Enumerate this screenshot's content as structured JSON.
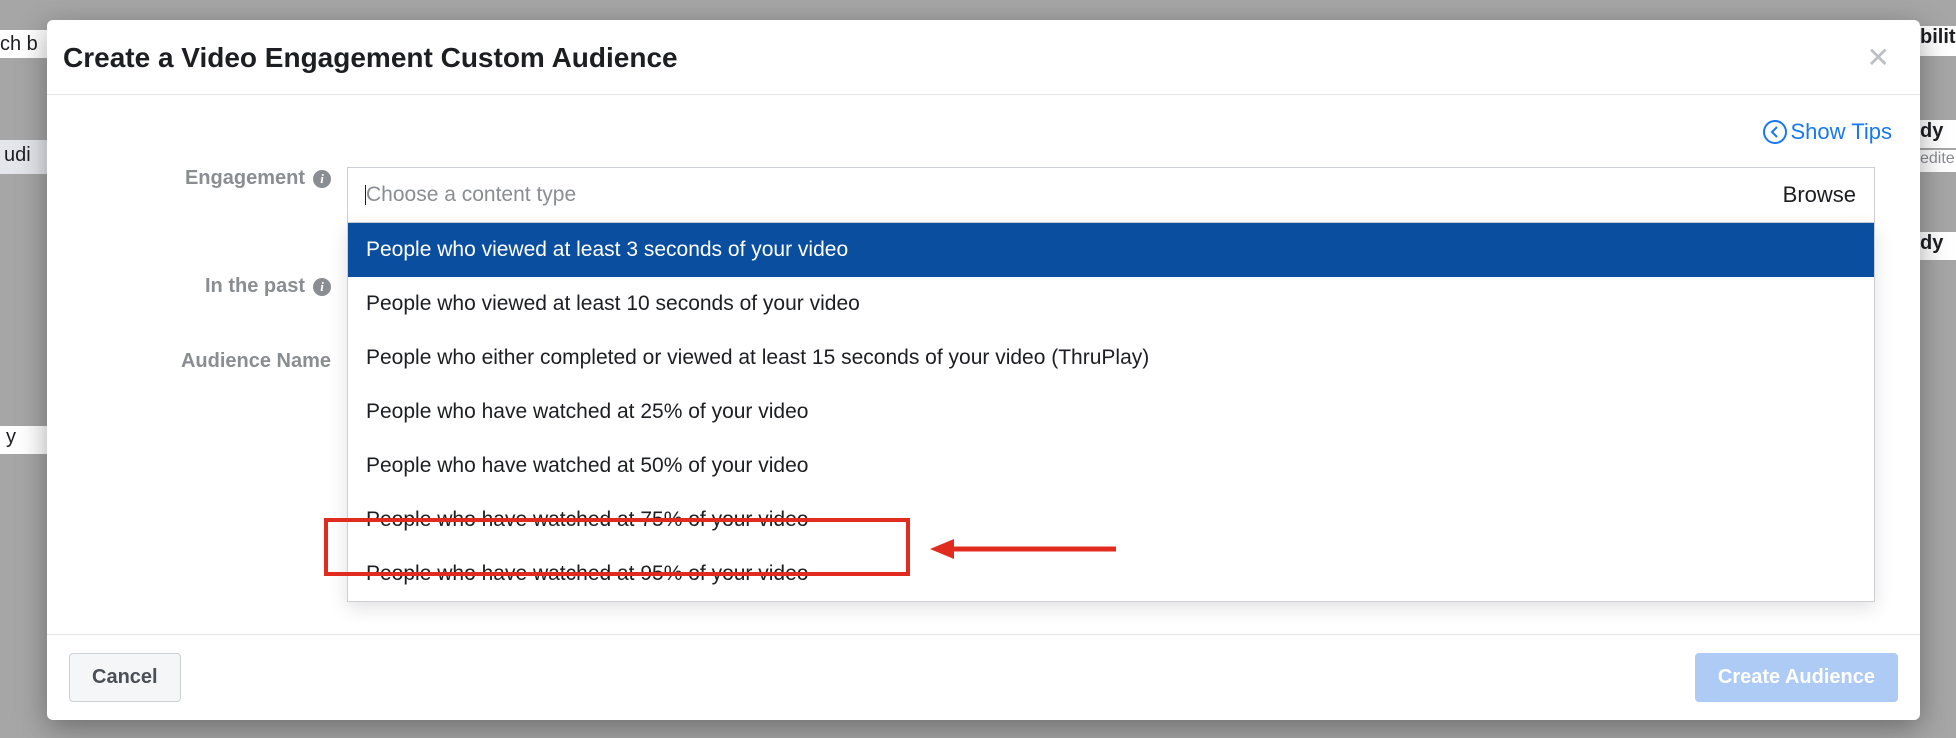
{
  "modal": {
    "title": "Create a Video Engagement Custom Audience",
    "show_tips": "Show Tips"
  },
  "labels": {
    "engagement": "Engagement",
    "in_the_past": "In the past",
    "audience_name": "Audience Name"
  },
  "engagement_input": {
    "placeholder": "Choose a content type",
    "browse": "Browse"
  },
  "dropdown_options": [
    "People who viewed at least 3 seconds of your video",
    "People who viewed at least 10 seconds of your video",
    "People who either completed or viewed at least 15 seconds of your video (ThruPlay)",
    "People who have watched at 25% of your video",
    "People who have watched at 50% of your video",
    "People who have watched at 75% of your video",
    "People who have watched at 95% of your video"
  ],
  "footer": {
    "cancel": "Cancel",
    "create": "Create Audience"
  },
  "bg": {
    "t1": "ch b",
    "t2": "bilit",
    "t3": "udi",
    "t4": "dy",
    "t5": "edite",
    "t6": "dy",
    "t7": "y"
  },
  "annotation": {
    "highlight_index": 4
  }
}
